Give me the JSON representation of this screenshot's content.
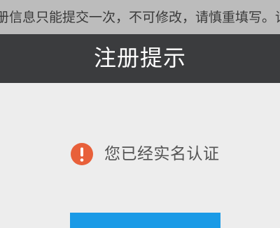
{
  "notice": {
    "text": "册信息只能提交一次，不可修改，请慎重填写。请"
  },
  "dialog": {
    "title": "注册提示",
    "message": "您已经实名认证",
    "icon": "alert-exclamation-icon",
    "icon_color": "#e8603a",
    "button_color": "#1a9ae6"
  }
}
